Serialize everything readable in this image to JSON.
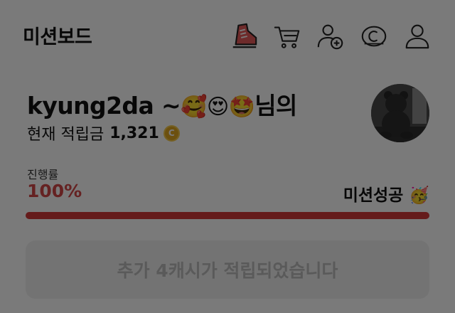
{
  "header": {
    "title": "미션보드",
    "icons": [
      "sneaker-icon",
      "cart-icon",
      "add-friend-icon",
      "cash-icon",
      "profile-icon"
    ]
  },
  "profile": {
    "username": "kyung2da ~",
    "emojis": "🥰😍🤩",
    "suffix": "님의",
    "points_label": "현재 적립금",
    "points_value": "1,321",
    "coin_symbol": "C"
  },
  "progress": {
    "label": "진행률",
    "value_text": "100%",
    "value": 1.0,
    "status": "미션성공",
    "status_emoji": "🥳"
  },
  "cta": {
    "label": "추가 4캐시가 적립되었습니다"
  },
  "colors": {
    "accent": "#d43a3a",
    "overlay": "rgba(0,0,0,0.52)",
    "coin": "#e2a820"
  }
}
